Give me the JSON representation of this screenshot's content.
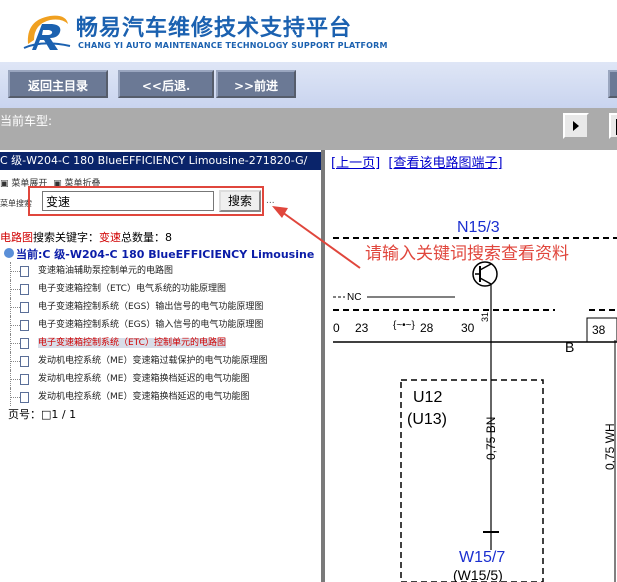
{
  "header": {
    "title_cn": "畅易汽车维修技术支持平台",
    "title_en": "CHANG YI AUTO MAINTENANCE TECHNOLOGY SUPPORT PLATFORM"
  },
  "nav": {
    "home": "返回主目录",
    "back": "<<后退.",
    "forward": ">>前进"
  },
  "modelbar": {
    "label": "当前车型:"
  },
  "left": {
    "model_strip": "C 级-W204-C 180 BlueEFFICIENCY Limousine-271820-G/",
    "menu_expand": "菜单展开",
    "menu_collapse": "菜单折叠",
    "search_label": "菜单搜索",
    "search_value": "变速",
    "search_button": "搜索",
    "ellipsis": "...",
    "result_prefix": "电路图",
    "result_mid": "搜索关键字：",
    "result_keyword": "变速",
    "result_count_label": "总数量：",
    "result_count": "8",
    "current": "当前:C 级-W204-C 180 BlueEFFICIENCY Limousine",
    "items": [
      "变速箱油辅助泵控制单元的电路图",
      "电子变速箱控制（ETC）电气系统的功能原理图",
      "电子变速箱控制系统（EGS）输出信号的电气功能原理图",
      "电子变速箱控制系统（EGS）输入信号的电气功能原理图",
      "电子变速箱控制系统（ETC）控制单元的电路图",
      "发动机电控系统（ME）变速箱过载保护的电气功能原理图",
      "发动机电控系统（ME）变速箱换档延迟的电气功能图",
      "发动机电控系统（ME）变速箱换档延迟的电气功能图"
    ],
    "selected_index": 4,
    "pager": "页号：□1 / 1"
  },
  "right": {
    "link_prev": "[上一页]",
    "link_terminal": "[查看该电路图端子]",
    "diagram": {
      "n15": "N15/3",
      "nc": "NC",
      "pin31": "31",
      "t0": "0",
      "t23": "23",
      "t28": "28",
      "t30": "30",
      "t38": "38",
      "b": "B",
      "u12": "U12",
      "u13": "(U13)",
      "wire": "0,75 BN",
      "wire2": "0,75 WH",
      "w15": "W15/7",
      "w15b": "(W15/5)"
    }
  },
  "annotation": "请输入关键词搜索查看资料",
  "colors": {
    "brand_blue": "#1b61b0",
    "nav_button": "#6b7995",
    "accent_red": "#e0463c",
    "link_blue": "#0000cc"
  }
}
